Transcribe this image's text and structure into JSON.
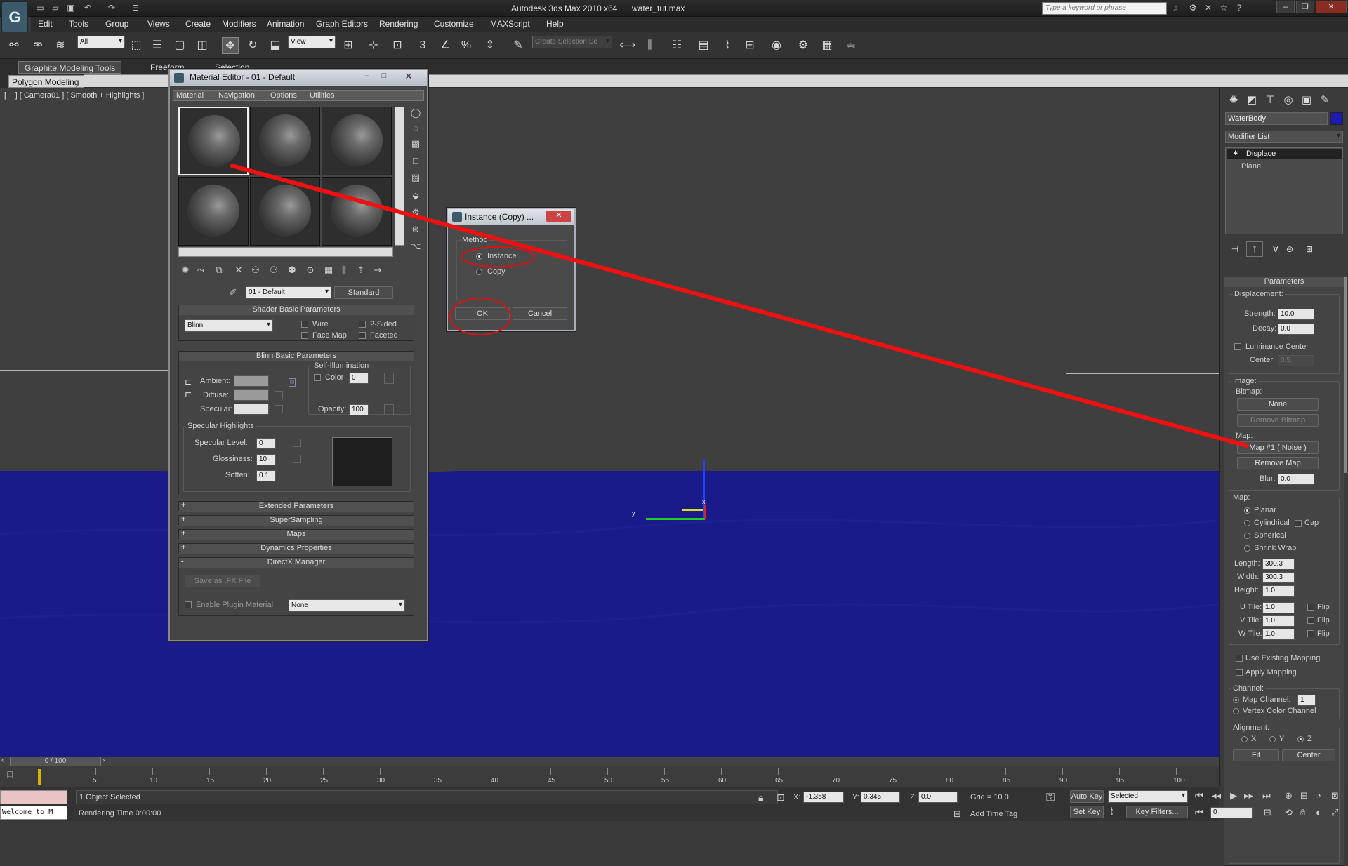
{
  "window": {
    "app_title": "Autodesk 3ds Max  2010 x64",
    "file_name": "water_tut.max",
    "search_placeholder": "Type a keyword or phrase",
    "logo_letter": "G"
  },
  "menu": [
    "Edit",
    "Tools",
    "Group",
    "Views",
    "Create",
    "Modifiers",
    "Animation",
    "Graph Editors",
    "Rendering",
    "Customize",
    "MAXScript",
    "Help"
  ],
  "toolbar": {
    "selection_filter": "All",
    "ref_coord": "View",
    "named_selection_placeholder": "Create Selection Se",
    "snap_label": "3",
    "angle_snap_label": "n",
    "percent_snap_label": "%"
  },
  "ribbon": {
    "tabs": [
      "Graphite Modeling Tools",
      "Freeform",
      "Selection"
    ],
    "sub_tab": "Polygon Modeling"
  },
  "viewport": {
    "label": "[ + ] [ Camera01 ] [ Smooth + Highlights ]",
    "water_color": "#1a1a8a",
    "gizmo_x": "x",
    "gizmo_y": "y"
  },
  "material_editor": {
    "title": "Material Editor - 01 - Default",
    "menu": [
      "Material",
      "Navigation",
      "Options",
      "Utilities"
    ],
    "material_name": "01 - Default",
    "material_type": "Standard",
    "shader_rollout": "Shader Basic Parameters",
    "shader_type": "Blinn",
    "shader_checks": [
      "Wire",
      "2-Sided",
      "Face Map",
      "Faceted"
    ],
    "blinn_rollout": "Blinn Basic Parameters",
    "self_illum_label": "Self-Illumination",
    "color_label": "Color",
    "color_value": "0",
    "ambient_label": "Ambient:",
    "diffuse_label": "Diffuse:",
    "specular_label": "Specular:",
    "opacity_label": "Opacity:",
    "opacity_value": "100",
    "specular_highlights_label": "Specular Highlights",
    "specular_level_label": "Specular Level:",
    "specular_level_value": "0",
    "glossiness_label": "Glossiness:",
    "glossiness_value": "10",
    "soften_label": "Soften:",
    "soften_value": "0.1",
    "collapsed_rollouts": [
      "Extended Parameters",
      "SuperSampling",
      "Maps",
      "Dynamics Properties"
    ],
    "directx_rollout": "DirectX Manager",
    "save_fx_label": "Save as .FX File",
    "enable_plugin_label": "Enable Plugin Material",
    "plugin_value": "None"
  },
  "instance_dialog": {
    "title": "Instance (Copy) ...",
    "method_label": "Method",
    "options": [
      "Instance",
      "Copy"
    ],
    "selected": "Instance",
    "ok_label": "OK",
    "cancel_label": "Cancel"
  },
  "command_panel": {
    "object_name": "WaterBody",
    "object_color": "#1b1bb5",
    "modifier_list_label": "Modifier List",
    "stack": [
      "Displace",
      "Plane"
    ],
    "parameters_rollout": "Parameters",
    "displacement_label": "Displacement:",
    "strength_label": "Strength:",
    "strength_value": "10.0",
    "decay_label": "Decay:",
    "decay_value": "0.0",
    "luminance_center_label": "Luminance Center",
    "center_label": "Center:",
    "center_value": "0.5",
    "image_label": "Image:",
    "bitmap_label": "Bitmap:",
    "bitmap_value": "None",
    "remove_bitmap_label": "Remove Bitmap",
    "map_label": "Map:",
    "map_value": "Map #1  ( Noise )",
    "remove_map_label": "Remove Map",
    "blur_label": "Blur:",
    "blur_value": "0.0",
    "mapping_label": "Map:",
    "mapping_options": [
      "Planar",
      "Cylindrical",
      "Spherical",
      "Shrink Wrap"
    ],
    "cap_label": "Cap",
    "length_label": "Length:",
    "length_value": "300.3",
    "width_label": "Width:",
    "width_value": "300.3",
    "height_label": "Height:",
    "height_value": "1.0",
    "utile_label": "U Tile:",
    "utile_value": "1.0",
    "vtile_label": "V Tile:",
    "vtile_value": "1.0",
    "wtile_label": "W Tile:",
    "wtile_value": "1.0",
    "flip_label": "Flip",
    "use_existing_label": "Use Existing Mapping",
    "apply_mapping_label": "Apply Mapping",
    "channel_label": "Channel:",
    "map_channel_label": "Map Channel:",
    "map_channel_value": "1",
    "vertex_color_label": "Vertex Color Channel",
    "alignment_label": "Alignment:",
    "axis_labels": [
      "X",
      "Y",
      "Z"
    ],
    "fit_label": "Fit",
    "center_btn_label": "Center"
  },
  "timeline": {
    "frame_counter": "0 / 100",
    "ticks": [
      "5",
      "10",
      "15",
      "20",
      "25",
      "30",
      "35",
      "40",
      "45",
      "50",
      "55",
      "60",
      "65",
      "70",
      "75",
      "80",
      "85",
      "90",
      "95",
      "100"
    ]
  },
  "status": {
    "maxscript_listener": "Welcome to M",
    "selection_text": "1 Object Selected",
    "rendering_time": "Rendering Time  0:00:00",
    "x_label": "X:",
    "x_value": "-1.358",
    "y_label": "Y:",
    "y_value": "0.345",
    "z_label": "Z:",
    "z_value": "0.0",
    "grid": "Grid = 10.0",
    "add_time_tag": "Add Time Tag",
    "auto_key": "Auto Key",
    "set_key": "Set Key",
    "key_mode": "Selected",
    "key_filters": "Key Filters...",
    "current_frame": "0"
  }
}
